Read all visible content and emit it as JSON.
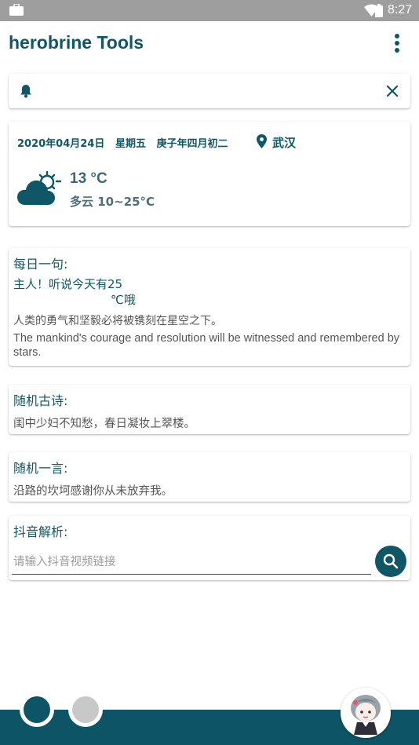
{
  "status_bar": {
    "time": "8:27"
  },
  "app_bar": {
    "title": "herobrine Tools"
  },
  "weather": {
    "date": "2020年04月24日",
    "weekday": "星期五",
    "lunar": "庚子年四月初二",
    "city": "武汉",
    "temperature": "13 °C",
    "description": "多云 10~25°C",
    "icon": "partly-cloudy-icon"
  },
  "daily_quote": {
    "title": "每日一句:",
    "greeting_line1": "主人！听说今天有25",
    "greeting_line2": "℃哦",
    "chinese": "人类的勇气和坚毅必将被镌刻在星空之下。",
    "english": "The mankind's courage and resolution will be witnessed and remembered by stars."
  },
  "random_poem": {
    "title": "随机古诗:",
    "text": "闺中少妇不知愁，春日凝妆上翠楼。"
  },
  "random_saying": {
    "title": "随机一言:",
    "text": "沿路的坎坷感谢你从未放弃我。"
  },
  "douyin_parse": {
    "title": "抖音解析:",
    "placeholder": "请输入抖音视频链接",
    "value": ""
  },
  "colors": {
    "accent": "#0f5766",
    "status_bar": "#9e9e9e",
    "bottom_bar": "#0d5566"
  }
}
